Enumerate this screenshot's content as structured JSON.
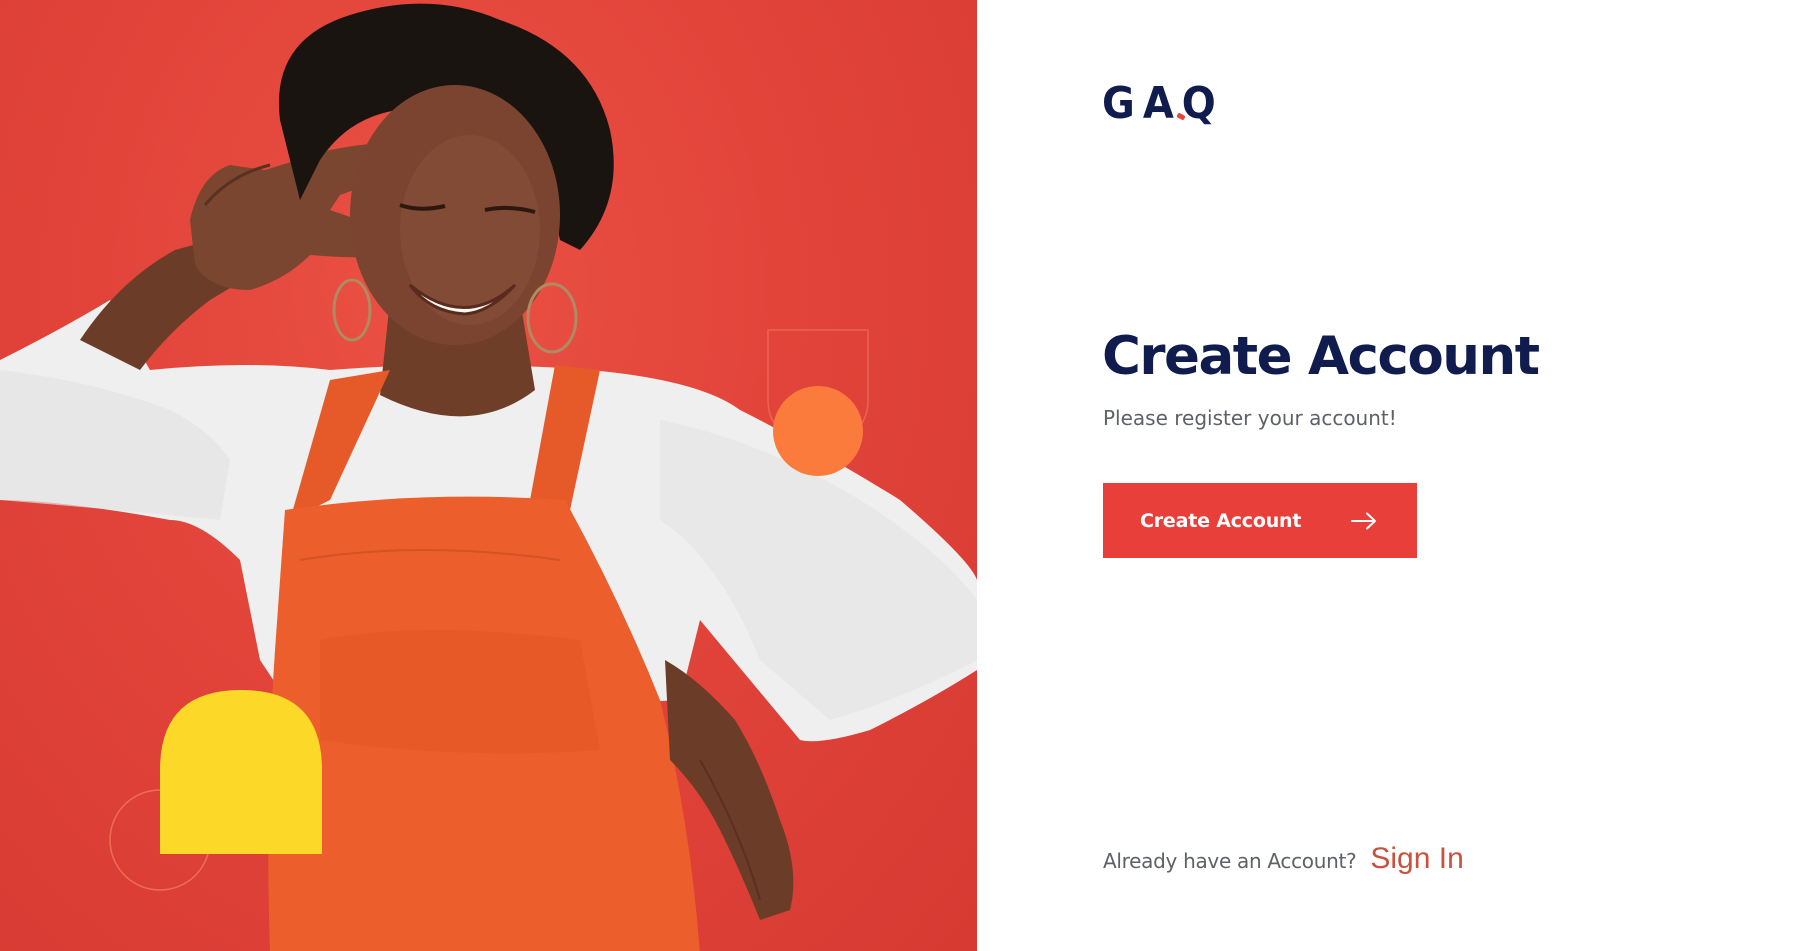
{
  "brand": {
    "logo_text": "GAQ",
    "primary_color": "#0f1c4d",
    "accent_color": "#e83f3a"
  },
  "hero": {
    "image_alt": "Smiling woman in orange overalls making a peace sign",
    "background_color": "#e2443a"
  },
  "form": {
    "title": "Create Account",
    "subtitle": "Please register your account!",
    "primary_button_label": "Create Account",
    "primary_button_icon": "arrow-right-icon"
  },
  "footer": {
    "prompt": "Already have an Account?",
    "link_label": "Sign In",
    "link_color": "#c8523e"
  }
}
